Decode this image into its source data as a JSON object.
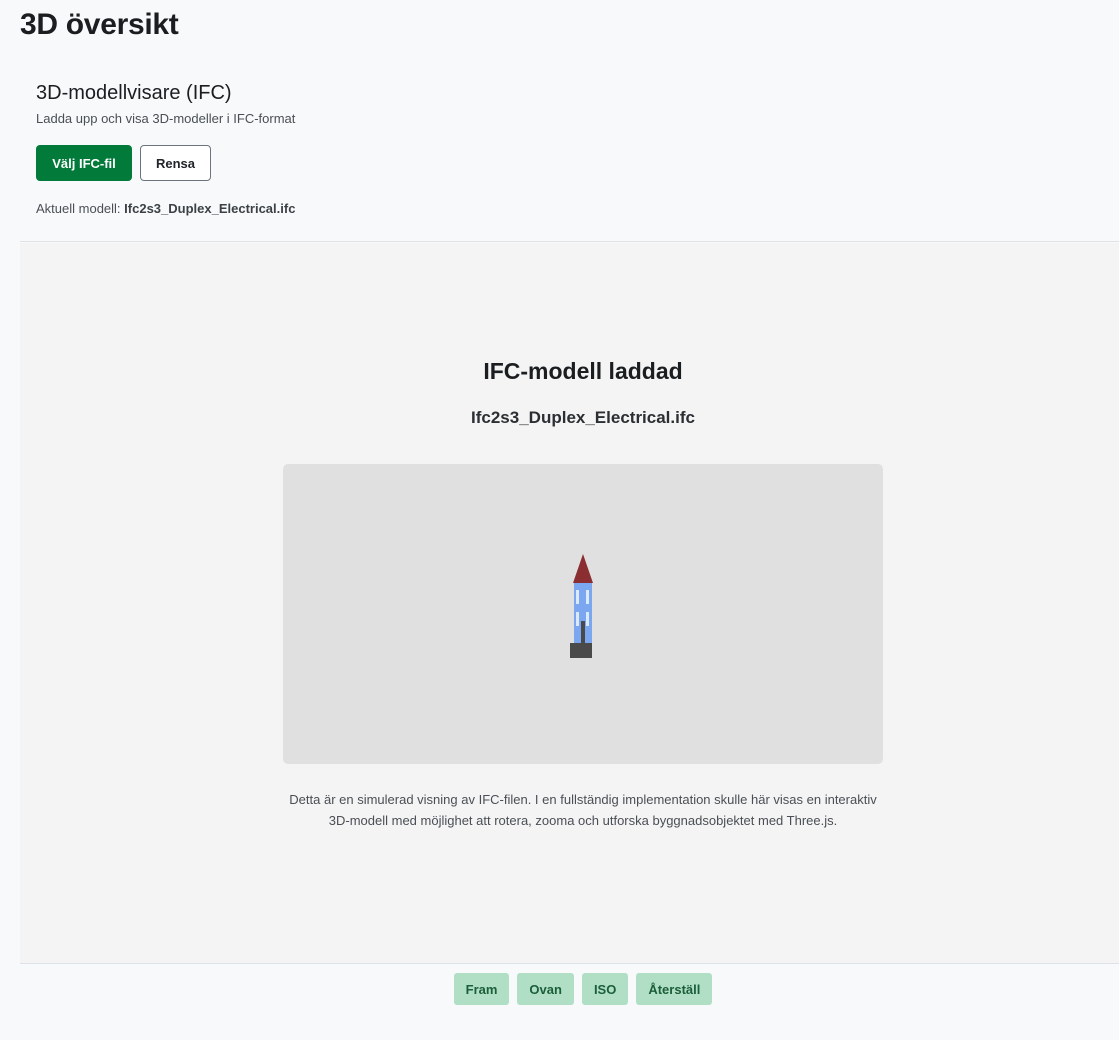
{
  "page": {
    "title": "3D översikt"
  },
  "viewer": {
    "title": "3D-modellvisare (IFC)",
    "subtitle": "Ladda upp och visa 3D-modeller i IFC-format",
    "choose_file_label": "Välj IFC-fil",
    "clear_label": "Rensa",
    "current_model_prefix": "Aktuell modell:",
    "current_model_name": "Ifc2s3_Duplex_Electrical.ifc"
  },
  "display": {
    "loaded_title": "IFC-modell laddad",
    "filename": "Ifc2s3_Duplex_Electrical.ifc",
    "preview_icon": "building-icon",
    "note": "Detta är en simulerad visning av IFC-filen. I en fullständig implementation skulle här visas en interaktiv 3D-modell med möjlighet att rotera, zooma och utforska byggnadsobjektet med Three.js."
  },
  "view_controls": {
    "front": "Fram",
    "top": "Ovan",
    "iso": "ISO",
    "reset": "Återställ"
  },
  "colors": {
    "primary": "#027a3a",
    "view_button_bg": "#b1dfc6",
    "view_button_text": "#1b5e3a",
    "roof": "#8b2e32",
    "walls": "#7ba7f0",
    "windows": "#dceaff",
    "base": "#4a4a4a"
  }
}
